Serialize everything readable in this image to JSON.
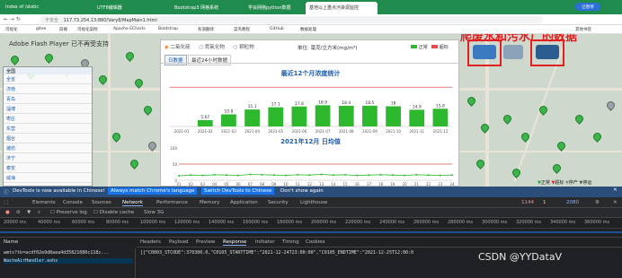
{
  "browser": {
    "tabs": [
      {
        "label": "Index of /static",
        "active": false
      },
      {
        "label": "UTF8编辑器",
        "active": false
      },
      {
        "label": "Bootstrap3 网格系统",
        "active": false
      },
      {
        "label": "学会网络python数据",
        "active": false
      },
      {
        "label": "基地以上重点污染源监控",
        "active": true
      }
    ],
    "address": {
      "security": "不安全",
      "url": "117.73.254.13:880/Vary8/MapMain1.html"
    },
    "bookmarks": [
      "可视化",
      "gitee",
      "前端",
      "可视化案例",
      "Apache ECharts",
      "Bootstrap",
      "有道翻译",
      "菜鸟教程",
      "GitHub",
      "数据处理",
      "其他书签"
    ]
  },
  "page": {
    "flash_notice": "Adobe Flash Player 已不再受支持",
    "sidebar": {
      "header": "全国",
      "items": [
        "全省",
        "济南",
        "青岛",
        "淄博",
        "枣庄",
        "东营",
        "烟台",
        "潍坊",
        "济宁",
        "泰安",
        "威海"
      ]
    },
    "panel": {
      "filters": [
        "二氧化硫",
        "氮氧化物",
        "颗粒物"
      ],
      "unit": "单位: 毫克/立方米(mg/m³)",
      "legend": [
        "正常",
        "超标"
      ],
      "tabs": [
        "日数据",
        "最近24小时数据"
      ]
    },
    "map_annotation": "爬废水和污水厂的数据",
    "map_legend": [
      "正常",
      "超标",
      "停产",
      "停运"
    ]
  },
  "chart_data": [
    {
      "type": "bar",
      "title": "最近12个月浓度统计",
      "categories": [
        "2021-01",
        "2021-02",
        "2021-03",
        "2021-04",
        "2021-05",
        "2021-06",
        "2021-07",
        "2021-08",
        "2021-09",
        "2021-10",
        "2021-11",
        "2021-12"
      ],
      "values": [
        0,
        5.67,
        10.8,
        15.1,
        17.1,
        17.8,
        18.9,
        18.4,
        18.5,
        18.0,
        14.9,
        15.8
      ],
      "labels": [
        "",
        "5.67",
        "10.8",
        "15.1",
        "17.1",
        "17.8",
        "18.9",
        "18.4",
        "18.5",
        "18",
        "14.9",
        "15.8"
      ],
      "ylim": [
        0,
        40
      ],
      "limit_line": 35
    },
    {
      "type": "line",
      "title": "2021年12月 日均值",
      "x": [
        "01",
        "02",
        "03",
        "04",
        "05",
        "06",
        "07",
        "08",
        "09",
        "10",
        "11",
        "12",
        "13",
        "14",
        "15",
        "16",
        "17",
        "18",
        "19",
        "20",
        "21",
        "22",
        "23",
        "24"
      ],
      "values": [
        14,
        16,
        15,
        17,
        16,
        15,
        18,
        17,
        16,
        15,
        17,
        16,
        18,
        16,
        17,
        15,
        16,
        17,
        16,
        15,
        17,
        16,
        15,
        16
      ],
      "yticks": [
        "100",
        "50",
        "0"
      ],
      "ylim": [
        0,
        100
      ],
      "limit_line": 50
    }
  ],
  "devtools": {
    "notice": "DevTools is now available in Chinese!",
    "notice_buttons": [
      "Always match Chrome's language",
      "Switch DevTools to Chinese",
      "Don't show again"
    ],
    "tabs": [
      "Elements",
      "Console",
      "Sources",
      "Network",
      "Performance",
      "Memory",
      "Application",
      "Security",
      "Lighthouse"
    ],
    "active_tab": "Network",
    "counts": [
      "1144",
      "1",
      "2080"
    ],
    "toolbar": {
      "preserve_log": "Preserve log",
      "disable_cache": "Disable cache",
      "throttle": "Slow 3G"
    },
    "timeline_ticks": [
      "20000 ms",
      "40000 ms",
      "60000 ms",
      "80000 ms",
      "100000 ms",
      "120000 ms",
      "140000 ms",
      "160000 ms",
      "180000 ms",
      "200000 ms",
      "220000 ms",
      "240000 ms",
      "260000 ms",
      "280000 ms",
      "300000 ms",
      "320000 ms",
      "340000 ms",
      "360000 ms"
    ],
    "columns": [
      "Name"
    ],
    "detail_tabs": [
      "Headers",
      "Payload",
      "Preview",
      "Response",
      "Initiator",
      "Timing",
      "Cookies"
    ],
    "active_detail": "Response",
    "requests": [
      "wmts?tk=acdf02e9d8aea4d35821080c118c...",
      "WasteAirHandler.ashx"
    ],
    "response_text": "[{\"C0003_STCODE\":370300.0,\"C0105_STARTTIME\":\"2021-12-24T23:00:00\",\"C0105_ENDTIME\":\"2021-12-25T12:00:0"
  },
  "watermark": "CSDN @YYDataV"
}
